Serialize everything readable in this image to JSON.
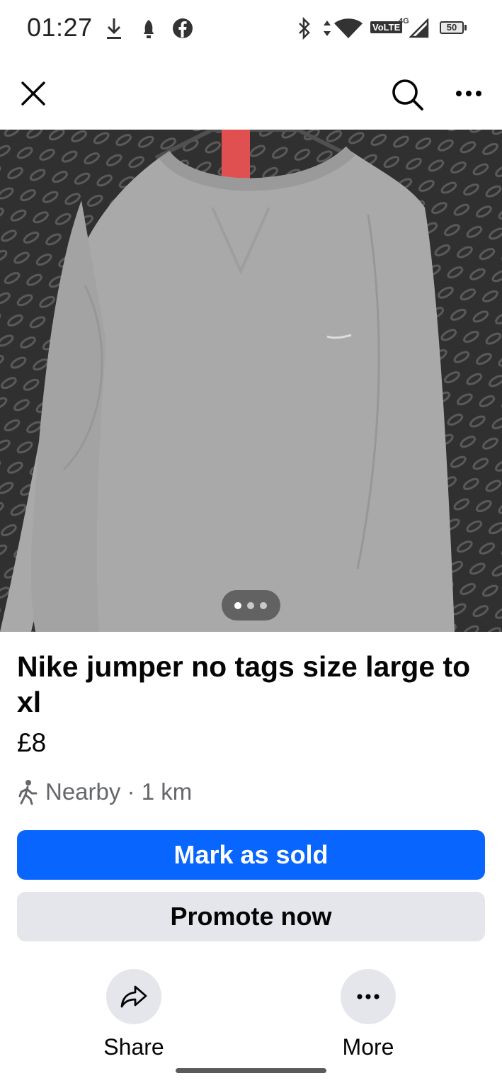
{
  "status_bar": {
    "time": "01:27",
    "volte": "VoLTE",
    "network": "4G",
    "battery": "50",
    "icons": [
      "download-icon",
      "notification-icon",
      "facebook-icon",
      "bluetooth-icon",
      "data-arrows-icon",
      "wifi-icon",
      "signal-icon",
      "battery-icon"
    ]
  },
  "top_bar": {
    "icons": [
      "close-icon",
      "search-icon",
      "more-options-icon"
    ]
  },
  "photo": {
    "description_icon": "jumper-photo",
    "pager_total": 3,
    "pager_active": 1
  },
  "listing": {
    "title": "Nike jumper no tags size large to xl",
    "price": "£8",
    "location": "Nearby · 1 km",
    "location_icon": "walking-person-icon"
  },
  "buttons": {
    "mark_sold": "Mark as sold",
    "promote": "Promote now"
  },
  "actions": [
    {
      "label": "Share",
      "icon": "share-arrow-icon"
    },
    {
      "label": "More",
      "icon": "more-dots-icon"
    }
  ],
  "colors": {
    "primary": "#0866ff",
    "secondary_bg": "#e4e6eb",
    "muted_text": "#65676b"
  }
}
